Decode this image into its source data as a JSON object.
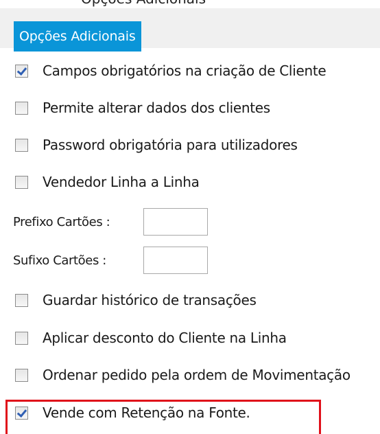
{
  "section": {
    "title": "Opções Adicionais"
  },
  "partial_top_text": "Opções Adicionais",
  "options_top": [
    {
      "label": "Campos obrigatórios na criação  de Cliente",
      "checked": true
    },
    {
      "label": "Permite alterar dados dos clientes",
      "checked": false
    },
    {
      "label": "Password obrigatória para utilizadores",
      "checked": false
    },
    {
      "label": "Vendedor Linha a Linha",
      "checked": false
    }
  ],
  "fields": {
    "prefixo": {
      "label": "Prefixo Cartões :",
      "value": ""
    },
    "sufixo": {
      "label": "Sufixo Cartões :",
      "value": ""
    }
  },
  "options_bottom": [
    {
      "label": "Guardar histórico de transações",
      "checked": false
    },
    {
      "label": "Aplicar desconto do Cliente na Linha",
      "checked": false
    },
    {
      "label": "Ordenar pedido pela ordem de Movimentação",
      "checked": false
    },
    {
      "label": "Vende com Retenção na Fonte.",
      "checked": true
    }
  ],
  "colors": {
    "tab_background": "#0a95d8",
    "highlight": "#e0101a",
    "check": "#2f5fb3"
  }
}
